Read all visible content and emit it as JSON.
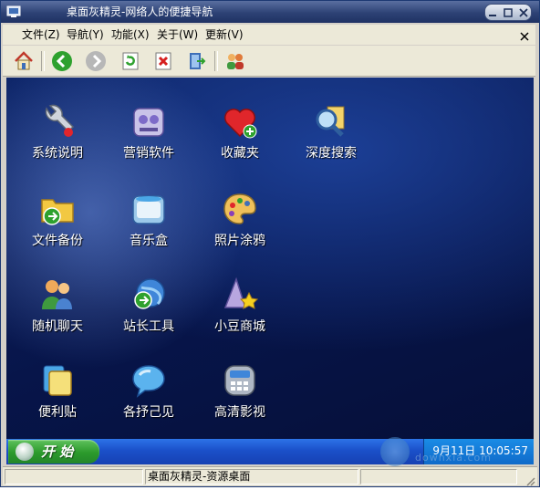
{
  "window": {
    "title": "桌面灰精灵-网络人的便捷导航"
  },
  "menu": {
    "items": [
      "文件(Z)",
      "导航(Y)",
      "功能(X)",
      "关于(W)",
      "更新(V)"
    ]
  },
  "toolbar": {
    "buttons": [
      "home-icon",
      "back-icon",
      "forward-icon",
      "refresh-icon",
      "stop-icon",
      "exit-icon",
      "users-icon"
    ]
  },
  "desktop": {
    "icons": [
      {
        "label": "系统说明",
        "icon": "wrench-icon"
      },
      {
        "label": "营销软件",
        "icon": "software-icon"
      },
      {
        "label": "收藏夹",
        "icon": "favorites-heart-icon"
      },
      {
        "label": "深度搜索",
        "icon": "magnifier-icon"
      },
      {
        "label": "文件备份",
        "icon": "folder-backup-icon"
      },
      {
        "label": "音乐盒",
        "icon": "music-box-icon"
      },
      {
        "label": "照片涂鸦",
        "icon": "palette-icon"
      },
      {
        "label": "随机聊天",
        "icon": "chat-users-icon"
      },
      {
        "label": "站长工具",
        "icon": "webmaster-tools-icon"
      },
      {
        "label": "小豆商城",
        "icon": "shop-star-icon"
      },
      {
        "label": "便利贴",
        "icon": "sticky-note-icon"
      },
      {
        "label": "各抒己见",
        "icon": "speech-bubble-icon"
      },
      {
        "label": "高清影视",
        "icon": "video-icon"
      }
    ]
  },
  "taskbar": {
    "start_label": "开 始",
    "clock": "9月11日 10:05:57"
  },
  "status": {
    "text": "桌面灰精灵-资源桌面"
  },
  "watermark": {
    "text": "downxia.com"
  },
  "colors": {
    "titlebar": "#2d4275",
    "desktop": "#0d2466",
    "taskbar": "#1b50c9",
    "start": "#2b9a2b"
  }
}
